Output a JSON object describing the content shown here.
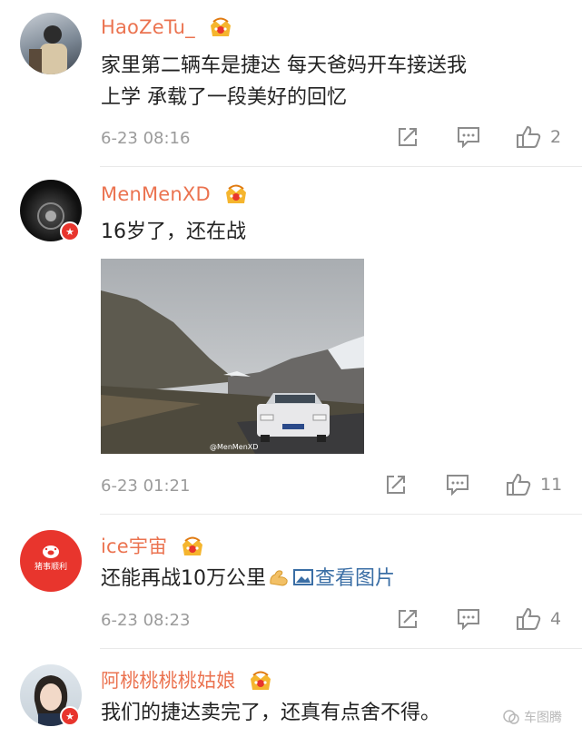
{
  "comments": [
    {
      "username": "HaoZeTu_",
      "text_lines": [
        "家里第二辆车是捷达 每天爸妈开车接送我",
        "上学 承载了一段美好的回忆"
      ],
      "time": "6-23 08:16",
      "likes": "2",
      "avatar_icon": "person-photo-avatar"
    },
    {
      "username": "MenMenXD",
      "text_lines": [
        "16岁了，还在战"
      ],
      "time": "6-23 01:21",
      "likes": "11",
      "photo_watermark": "@MenMenXD",
      "avatar_icon": "dark-avatar"
    },
    {
      "username": "ice宇宙",
      "text_prefix": "还能再战10万公里",
      "emoji": "flex-arm-emoji",
      "pic_link": "查看图片",
      "time": "6-23 08:23",
      "likes": "4",
      "avatar_icon": "pig-logo-avatar",
      "avatar_text": "猪事顺利"
    },
    {
      "username": "阿桃桃桃桃姑娘",
      "text_lines": [
        "我们的捷达卖完了，还真有点舍不得。"
      ],
      "avatar_icon": "girl-photo-avatar"
    }
  ],
  "watermark": "车图腾",
  "colors": {
    "username": "#eb7350",
    "text": "#222222",
    "meta": "#9b9b9b",
    "badge": "#e8352d",
    "link": "#3a6ea5"
  }
}
